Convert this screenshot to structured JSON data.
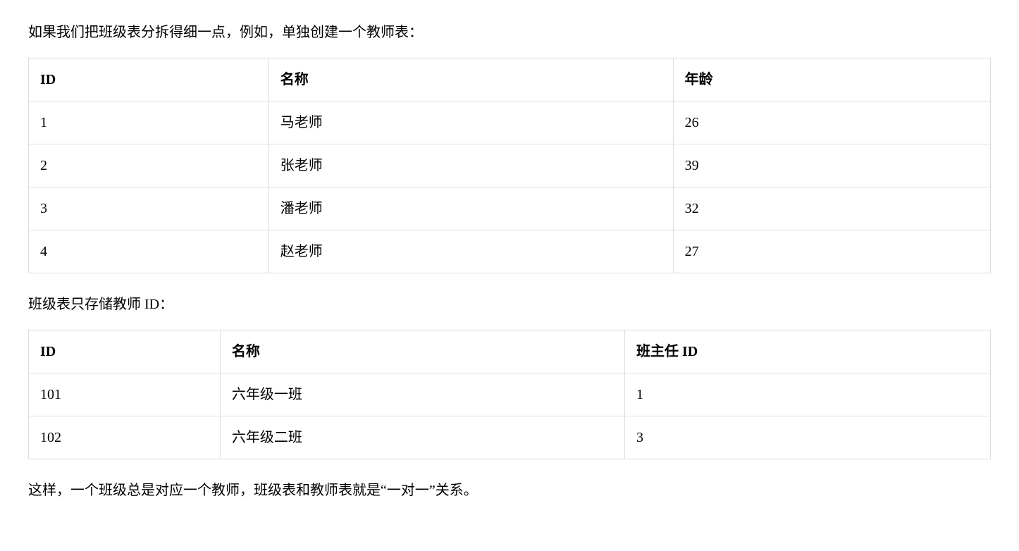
{
  "intro_text": "如果我们把班级表分拆得细一点，例如，单独创建一个教师表：",
  "teacher_table": {
    "headers": {
      "id": "ID",
      "name": "名称",
      "age": "年龄"
    },
    "rows": [
      {
        "id": "1",
        "name": "马老师",
        "age": "26"
      },
      {
        "id": "2",
        "name": "张老师",
        "age": "39"
      },
      {
        "id": "3",
        "name": "潘老师",
        "age": "32"
      },
      {
        "id": "4",
        "name": "赵老师",
        "age": "27"
      }
    ]
  },
  "middle_text": "班级表只存储教师 ID：",
  "class_table": {
    "headers": {
      "id": "ID",
      "name": "名称",
      "teacher_id": "班主任 ID"
    },
    "rows": [
      {
        "id": "101",
        "name": "六年级一班",
        "teacher_id": "1"
      },
      {
        "id": "102",
        "name": "六年级二班",
        "teacher_id": "3"
      }
    ]
  },
  "conclusion_text": "这样，一个班级总是对应一个教师，班级表和教师表就是“一对一”关系。"
}
